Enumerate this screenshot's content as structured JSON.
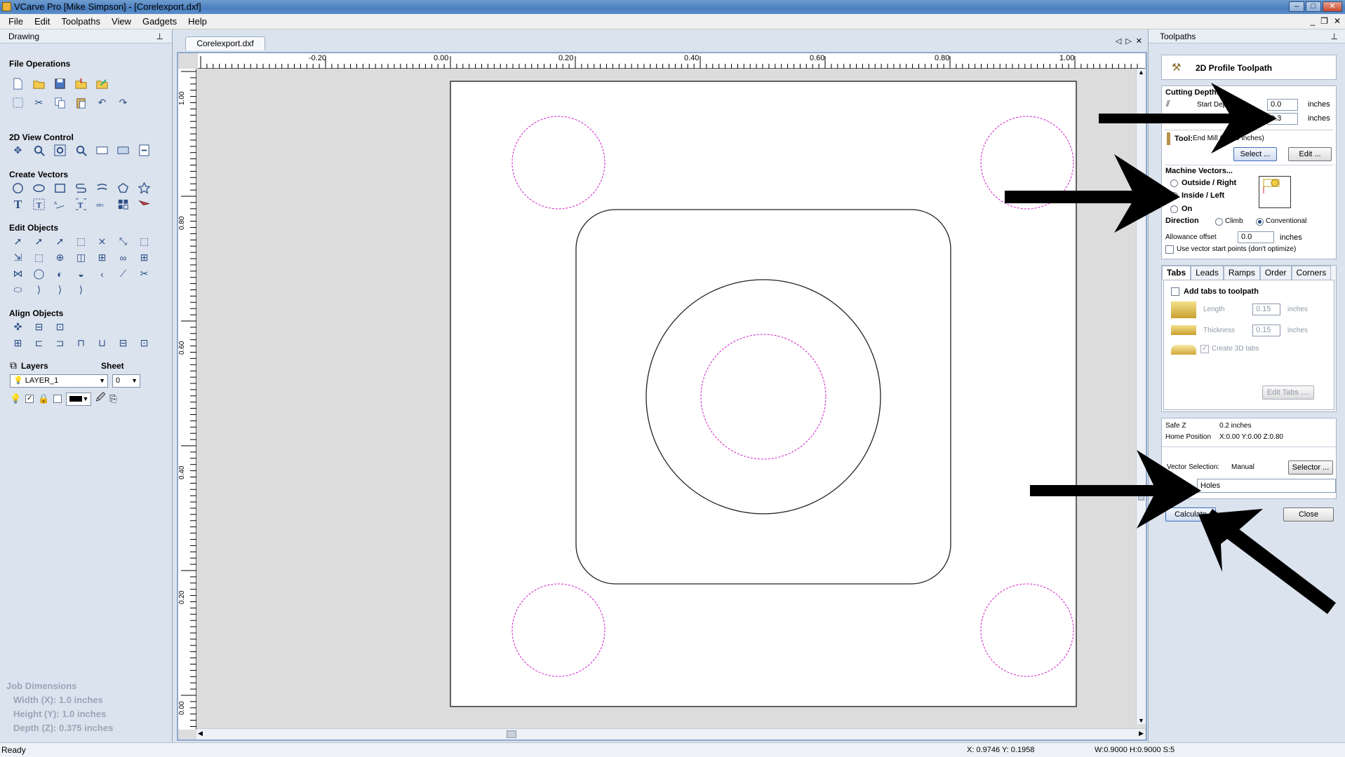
{
  "window": {
    "title": "VCarve Pro [Mike Simpson] - [Corelexport.dxf]"
  },
  "menu": {
    "items": [
      "File",
      "Edit",
      "Toolpaths",
      "View",
      "Gadgets",
      "Help"
    ]
  },
  "left_panel": {
    "title": "Drawing",
    "sections": {
      "file_ops": "File Operations",
      "view_control": "2D View Control",
      "create_vectors": "Create Vectors",
      "edit_objects": "Edit Objects",
      "align_objects": "Align Objects"
    },
    "layers_label": "Layers",
    "sheet_label": "Sheet",
    "layer_value": "LAYER_1",
    "sheet_value": "0",
    "job_dims": {
      "heading": "Job Dimensions",
      "width": "Width  (X): 1.0 inches",
      "height": "Height (Y): 1.0 inches",
      "depth": "Depth  (Z): 0.375 inches"
    }
  },
  "document": {
    "tab": "Corelexport.dxf",
    "ruler_top": [
      "-0.20",
      "0.00",
      "0.20",
      "0.40",
      "0.60",
      "0.80",
      "1.00"
    ],
    "ruler_left": [
      "1.00",
      "0.80",
      "0.60",
      "0.40",
      "0.20",
      "0.00"
    ]
  },
  "toolpaths": {
    "panel_title": "Toolpaths",
    "header": "2D Profile Toolpath",
    "cutting_depths": "Cutting Depths",
    "start_depth_label": "Start Depth (D)",
    "start_depth": "0.0",
    "cut_depth": "0.3",
    "units": "inches",
    "tool_label": "Tool:",
    "tool_value": "End Mill (0.125 inches)",
    "select_btn": "Select ...",
    "edit_btn": "Edit ...",
    "machine_vectors": "Machine Vectors...",
    "outside_right": "Outside / Right",
    "inside_left": "Inside / Left",
    "on": "On",
    "direction": "Direction",
    "climb": "Climb",
    "conventional": "Conventional",
    "allowance_label": "Allowance offset",
    "allowance": "0.0",
    "use_vector_start": "Use vector start points (don't optimize)",
    "tabs": [
      "Tabs",
      "Leads",
      "Ramps",
      "Order",
      "Corners"
    ],
    "add_tabs": "Add tabs to toolpath",
    "length_label": "Length",
    "length": "0.15",
    "thickness_label": "Thickness",
    "thickness": "0.15",
    "create_3d_tabs": "Create 3D tabs",
    "edit_tabs_btn": "Edit Tabs ....",
    "safe_z_label": "Safe Z",
    "safe_z": "0.2 inches",
    "home_label": "Home Position",
    "home": "X:0.00 Y:0.00 Z:0.80",
    "vector_sel_label": "Vector Selection:",
    "vector_sel_mode": "Manual",
    "selector_btn": "Selector ...",
    "name": "Holes",
    "calculate_btn": "Calculate",
    "close_btn": "Close"
  },
  "status": {
    "left": "Ready",
    "coords": "X: 0.9746 Y: 0.1958",
    "dims": "W:0.9000  H:0.9000  S:5"
  }
}
